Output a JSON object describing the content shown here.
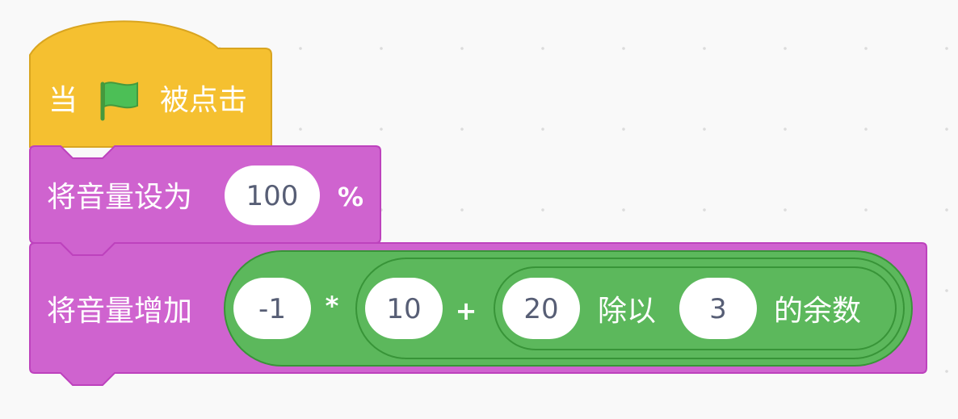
{
  "hat_block": {
    "prefix": "当",
    "icon": "green-flag-icon",
    "suffix": "被点击"
  },
  "set_volume_block": {
    "label": "将音量设为",
    "value": "100",
    "unit": "%"
  },
  "change_volume_block": {
    "label": "将音量增加",
    "value_a": "-1",
    "multiply_op": "*",
    "value_b": "10",
    "plus_op": "+",
    "value_c": "20",
    "mod_label": "除以",
    "value_d": "3",
    "mod_suffix": "的余数"
  },
  "colors": {
    "events": "#f5c030",
    "events_border": "#d9a520",
    "sound": "#cf63cf",
    "sound_border": "#bd42bd",
    "operators": "#5cb85c",
    "operators_border": "#389438",
    "flag_fill": "#4cbf56",
    "flag_stroke": "#45993d"
  }
}
